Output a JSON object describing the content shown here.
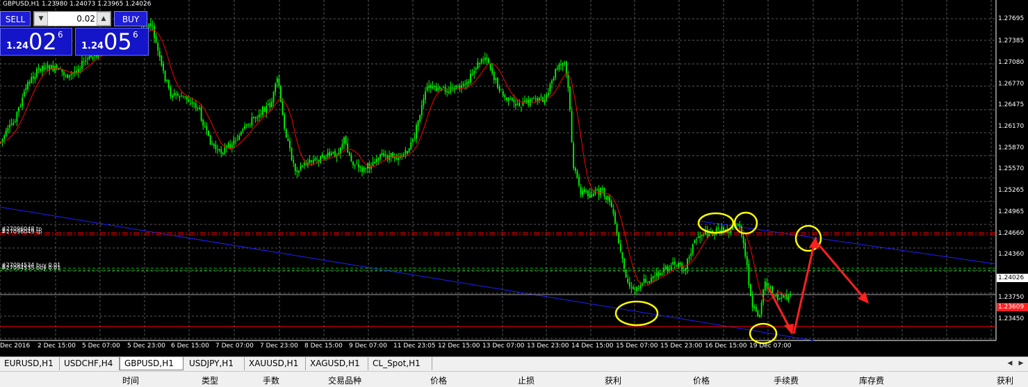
{
  "chart": {
    "title": "GBPUSD,H1  1.23980 1.24073 1.23965 1.24026",
    "price_levels": [
      "1.27695",
      "1.27385",
      "1.27080",
      "1.26770",
      "1.26475",
      "1.26170",
      "1.25870",
      "1.25570",
      "1.25265",
      "1.24965",
      "1.24660",
      "1.24360",
      "1.24026",
      "1.23750",
      "1.23609",
      "1.23450"
    ],
    "current_price": "1.24026",
    "stop_price": "1.23609",
    "time_labels": [
      "Dec 2016",
      "2 Dec 15:00",
      "5 Dec 07:00",
      "5 Dec 23:00",
      "6 Dec 15:00",
      "7 Dec 07:00",
      "7 Dec 23:00",
      "8 Dec 15:00",
      "9 Dec 07:00",
      "11 Dec 23:05",
      "12 Dec 15:00",
      "13 Dec 07:00",
      "13 Dec 23:00",
      "14 Dec 15:00",
      "15 Dec 07:00",
      "15 Dec 23:00",
      "16 Dec 15:00",
      "19 Dec 07:00"
    ],
    "order_labels": [
      "#27096048 tp",
      "#27096049 tp",
      "#27094534 buy 0.01",
      "#27094535 buy 0.01"
    ],
    "colors": {
      "background": "#000000",
      "grid": "#5a5a5a",
      "candles": "#00ff00",
      "moving_average": "#ff0000",
      "trendline": "#2020ff",
      "tp_line": "#ff0000",
      "buy_line": "#00c000",
      "stop_line": "#ff0000",
      "annotations_circle": "#ffff00",
      "annotations_arrow": "#ff2020"
    }
  },
  "trade_panel": {
    "sell_label": "SELL",
    "buy_label": "BUY",
    "lot_value": "0.02",
    "down_arrow": "▼",
    "up_arrow": "▲",
    "sell_prefix": "1.24",
    "sell_big": "02",
    "sell_sup": "6",
    "buy_prefix": "1.24",
    "buy_big": "05",
    "buy_sup": "6"
  },
  "tabs": [
    "EURUSD,H1",
    "USDCHF,H4",
    "GBPUSD,H1",
    "USDJPY,H1",
    "XAUUSD,H1",
    "XAGUSD,H1",
    "CL_Spot,H1"
  ],
  "active_tab": "GBPUSD,H1",
  "scroll": {
    "left": "◀",
    "right": "▶"
  },
  "terminal_columns": [
    "时间",
    "类型",
    "手数",
    "交易品种",
    "价格",
    "止损",
    "获利",
    "价格",
    "手续费",
    "库存费",
    "获利"
  ]
}
